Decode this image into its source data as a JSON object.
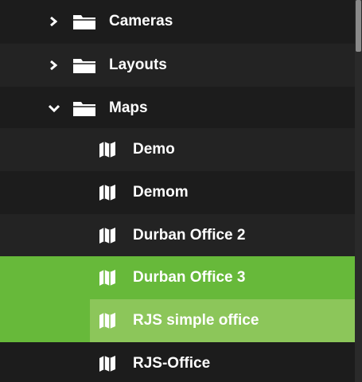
{
  "tree": {
    "folders": [
      {
        "label": "Cameras",
        "expanded": false,
        "chevron": "chevron-right-icon",
        "icon": "folder-icon"
      },
      {
        "label": "Layouts",
        "expanded": false,
        "chevron": "chevron-right-icon",
        "icon": "folder-icon"
      },
      {
        "label": "Maps",
        "expanded": true,
        "chevron": "chevron-down-icon",
        "icon": "folder-icon"
      }
    ],
    "maps": [
      {
        "label": "Demo",
        "icon": "map-icon",
        "state": "normal"
      },
      {
        "label": "Demom",
        "icon": "map-icon",
        "state": "normal"
      },
      {
        "label": "Durban Office 2",
        "icon": "map-icon",
        "state": "normal"
      },
      {
        "label": "Durban Office 3",
        "icon": "map-icon",
        "state": "selected"
      },
      {
        "label": "RJS simple office",
        "icon": "map-icon",
        "state": "hover"
      },
      {
        "label": "RJS-Office",
        "icon": "map-icon",
        "state": "normal"
      }
    ]
  },
  "colors": {
    "background": "#1e1e1e",
    "selected": "#67b93a",
    "hover": "#8cc65a",
    "text": "#ffffff"
  }
}
